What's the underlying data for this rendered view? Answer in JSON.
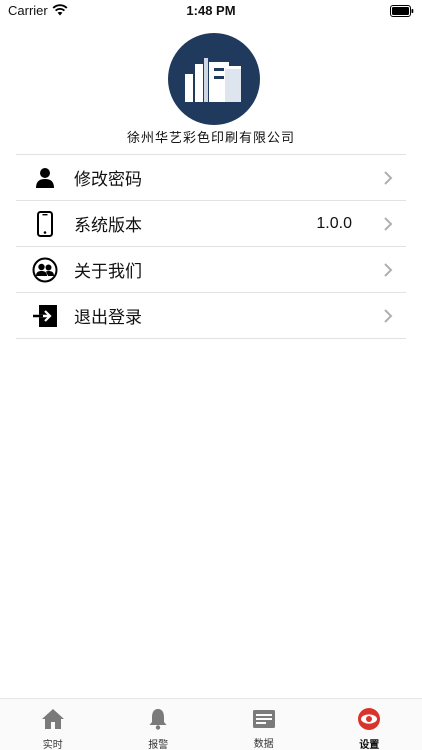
{
  "status_bar": {
    "carrier": "Carrier",
    "time": "1:48 PM"
  },
  "header": {
    "company_name": "徐州华艺彩色印刷有限公司",
    "logo_icon": "building-icon",
    "logo_color": "#1f3a5c"
  },
  "menu": {
    "items": [
      {
        "label": "修改密码",
        "icon": "user-icon",
        "value": ""
      },
      {
        "label": "系统版本",
        "icon": "phone-icon",
        "value": "1.0.0"
      },
      {
        "label": "关于我们",
        "icon": "group-icon",
        "value": ""
      },
      {
        "label": "退出登录",
        "icon": "logout-icon",
        "value": ""
      }
    ]
  },
  "tab_bar": {
    "active_color": "#d9342b",
    "tabs": [
      {
        "label": "实时",
        "icon": "home-icon",
        "active": false
      },
      {
        "label": "报警",
        "icon": "bell-icon",
        "active": false
      },
      {
        "label": "数据",
        "icon": "data-icon",
        "active": false
      },
      {
        "label": "设置",
        "icon": "eye-icon",
        "active": true
      }
    ]
  }
}
